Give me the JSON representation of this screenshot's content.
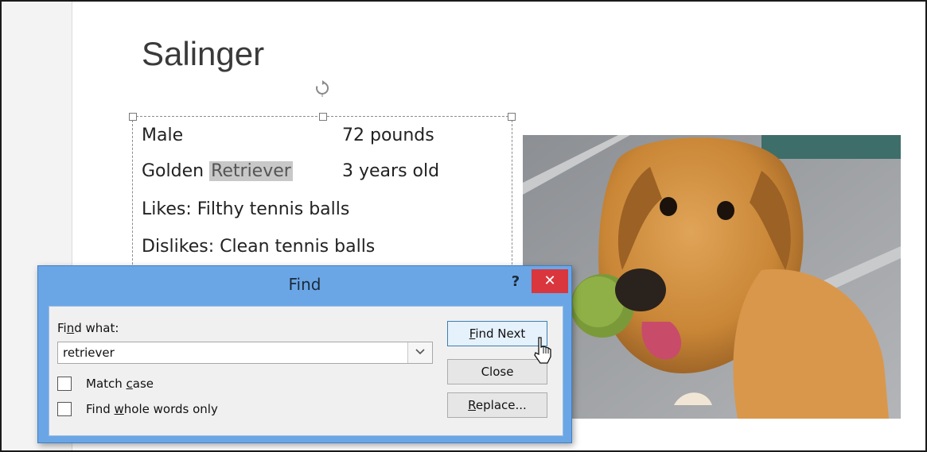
{
  "slide": {
    "title": "Salinger",
    "rows": [
      {
        "left": "Male",
        "right": "72 pounds"
      },
      {
        "left_pre": "Golden ",
        "left_highlight": "Retriever",
        "right": "3 years old"
      },
      {
        "left": "Likes: Filthy tennis balls"
      },
      {
        "left": "Dislikes: Clean tennis balls"
      }
    ],
    "highlight_color": "#c8c8c8"
  },
  "dialog": {
    "title": "Find",
    "help": "?",
    "close": "✕",
    "find_what_label_pre": "Fi",
    "find_what_label_u": "n",
    "find_what_label_post": "d what:",
    "find_value": "retriever",
    "match_case_pre": "Match ",
    "match_case_u": "c",
    "match_case_post": "ase",
    "whole_words_pre": "Find ",
    "whole_words_u": "w",
    "whole_words_post": "hole words only",
    "find_next_u": "F",
    "find_next_post": "ind Next",
    "close_label": "Close",
    "replace_u": "R",
    "replace_post": "eplace...",
    "title_bar_color": "#6aa6e6",
    "close_color": "#d9363e"
  },
  "icons": {
    "rotate": "rotate-icon",
    "dropdown": "chevron-down-icon",
    "cursor": "mouse-pointer-icon"
  }
}
